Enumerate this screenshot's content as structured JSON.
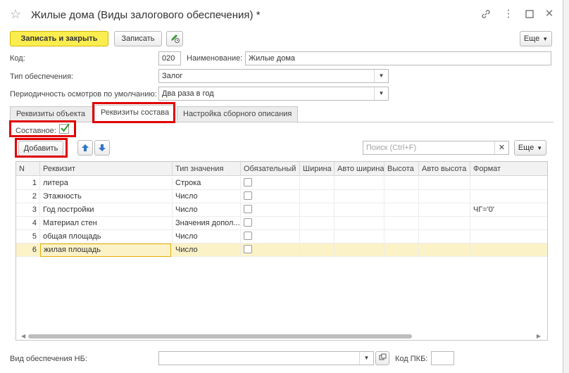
{
  "window": {
    "title": "Жилые дома (Виды залогового обеспечения) *"
  },
  "toolbar": {
    "save_close_label": "Записать и закрыть",
    "save_label": "Записать",
    "more_label": "Еще"
  },
  "form": {
    "code_label": "Код:",
    "code_value": "020",
    "name_label": "Наименование:",
    "name_value": "Жилые дома",
    "security_type_label": "Тип обеспечения:",
    "security_type_value": "Залог",
    "inspection_label": "Периодичность осмотров по умолчанию:",
    "inspection_value": "Два раза в год"
  },
  "tabs": [
    {
      "label": "Реквизиты объекта"
    },
    {
      "label": "Реквизиты состава"
    },
    {
      "label": "Настройка сборного описания"
    }
  ],
  "composite": {
    "label": "Составное:",
    "checked": true
  },
  "grid_toolbar": {
    "add_label": "Добавить",
    "search_placeholder": "Поиск (Ctrl+F)",
    "more_label": "Еще"
  },
  "table": {
    "columns": [
      "N",
      "Реквизит",
      "Тип значения",
      "Обязательный",
      "Ширина",
      "Авто ширина",
      "Высота",
      "Авто высота",
      "Формат"
    ],
    "rows": [
      {
        "n": "1",
        "name": "литера",
        "type": "Строка",
        "format": ""
      },
      {
        "n": "2",
        "name": "Этажность",
        "type": "Число",
        "format": ""
      },
      {
        "n": "3",
        "name": "Год постройки",
        "type": "Число",
        "format": "ЧГ='0'"
      },
      {
        "n": "4",
        "name": "Материал стен",
        "type": "Значения допол...",
        "format": ""
      },
      {
        "n": "5",
        "name": "общая площадь",
        "type": "Число",
        "format": ""
      },
      {
        "n": "6",
        "name": "жилая площадь",
        "type": "Число",
        "format": ""
      }
    ],
    "selected_row": 6
  },
  "footer": {
    "nb_label": "Вид обеспечения НБ:",
    "nb_value": "",
    "pkb_label": "Код ПКБ:",
    "pkb_value": ""
  },
  "colors": {
    "primary_button": "#fbed4f",
    "highlight_box": "#e00000",
    "selected_row": "#fbf2c8",
    "checkmark": "#2e9e2e"
  }
}
